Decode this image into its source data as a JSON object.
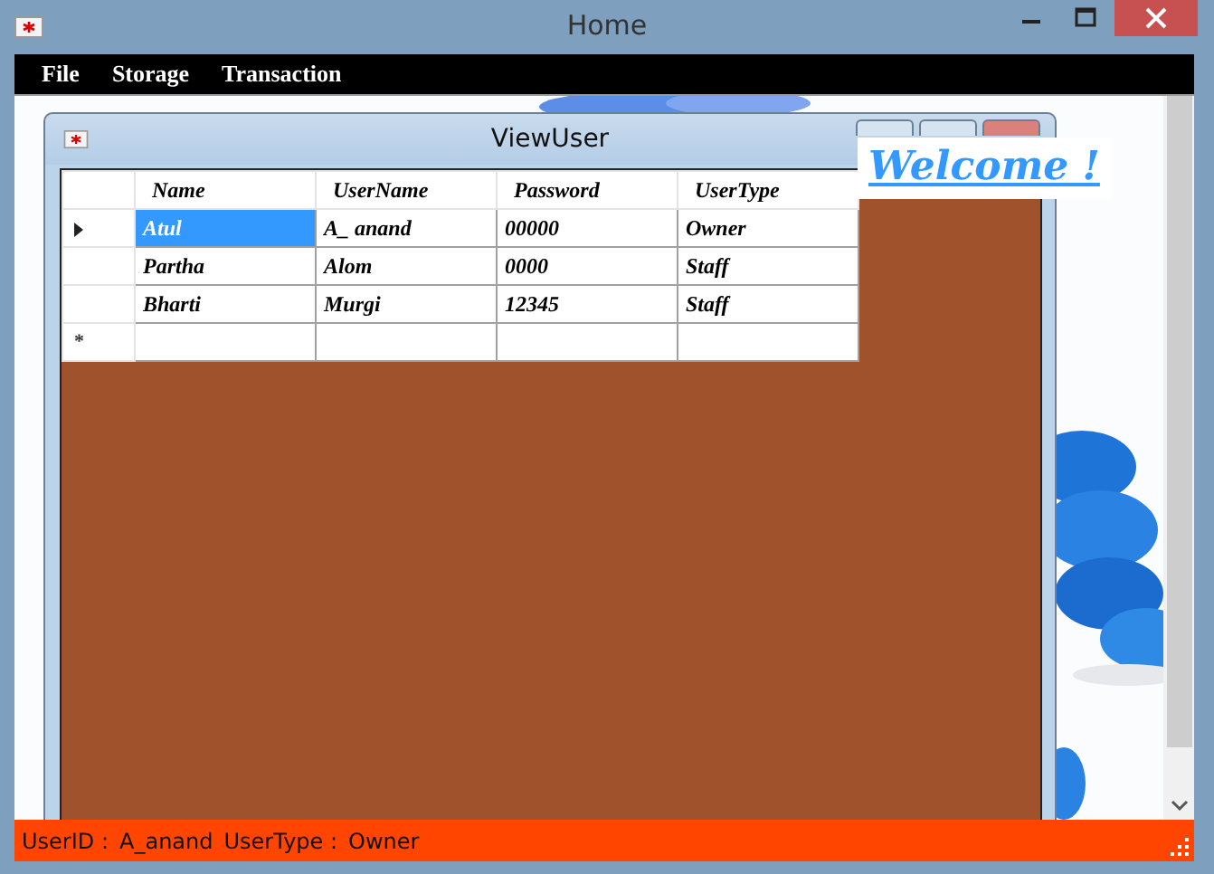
{
  "window": {
    "title": "Home"
  },
  "menu": [
    {
      "label": "File"
    },
    {
      "label": "Storage"
    },
    {
      "label": "Transaction"
    }
  ],
  "child_window": {
    "title": "ViewUser",
    "grid": {
      "columns": [
        "Name",
        "UserName",
        "Password",
        "UserType"
      ],
      "rows": [
        {
          "selected": true,
          "cells": [
            {
              "text": "Atul",
              "selected": true
            },
            {
              "text": "A_ anand",
              "selected": false
            },
            {
              "text": "00000",
              "selected": false
            },
            {
              "text": "Owner",
              "selected": false
            }
          ]
        },
        {
          "selected": false,
          "cells": [
            {
              "text": "Partha",
              "selected": false
            },
            {
              "text": "Alom",
              "selected": false
            },
            {
              "text": "0000",
              "selected": false
            },
            {
              "text": "Staff",
              "selected": false
            }
          ]
        },
        {
          "selected": false,
          "cells": [
            {
              "text": "Bharti",
              "selected": false
            },
            {
              "text": "Murgi",
              "selected": false
            },
            {
              "text": "12345",
              "selected": false
            },
            {
              "text": "Staff",
              "selected": false
            }
          ]
        }
      ],
      "new_row_marker": "*"
    }
  },
  "welcome": "Welcome !",
  "status_bar": [
    {
      "text": "UserID :"
    },
    {
      "text": "A_anand"
    },
    {
      "text": "UserType :"
    },
    {
      "text": "Owner"
    }
  ]
}
